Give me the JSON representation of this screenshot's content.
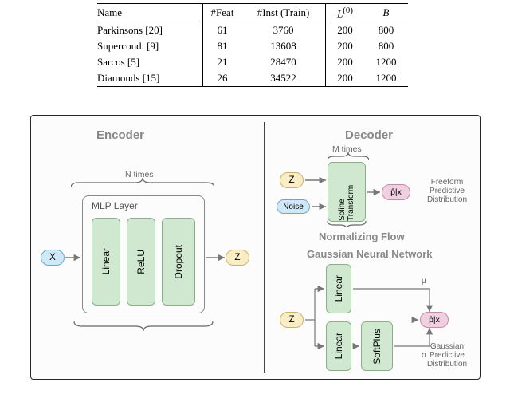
{
  "table": {
    "headers": {
      "name": "Name",
      "feat": "#Feat",
      "inst": "#Inst (Train)",
      "L": "L",
      "L_sup": "(0)",
      "B": "B"
    },
    "rows": [
      {
        "name": "Parkinsons [20]",
        "feat": "61",
        "inst": "3760",
        "L": "200",
        "B": "800"
      },
      {
        "name": "Supercond. [9]",
        "feat": "81",
        "inst": "13608",
        "L": "200",
        "B": "800"
      },
      {
        "name": "Sarcos [5]",
        "feat": "21",
        "inst": "28470",
        "L": "200",
        "B": "1200"
      },
      {
        "name": "Diamonds [15]",
        "feat": "26",
        "inst": "34522",
        "L": "200",
        "B": "1200"
      }
    ]
  },
  "fig": {
    "titles": {
      "enc": "Encoder",
      "dec": "Decoder"
    },
    "repeats": {
      "enc": "N times",
      "dec": "M times"
    },
    "mlp_label": "MLP Layer",
    "section": {
      "nf": "Normalizing Flow",
      "gnn": "Gaussian Neural Network"
    },
    "node": {
      "x": "X",
      "z": "Z",
      "noise": "Noise",
      "phat": "p̂|x"
    },
    "block": {
      "linear": "Linear",
      "relu": "ReLU",
      "dropout": "Dropout",
      "spline": "Spline Transform",
      "softplus": "SoftPlus"
    },
    "greek": {
      "mu": "μ",
      "sigma": "σ"
    },
    "side": {
      "freeform": [
        "Freeform",
        "Predictive",
        "Distribution"
      ],
      "gaussian": [
        "Gaussian",
        "Predictive",
        "Distribution"
      ]
    }
  }
}
